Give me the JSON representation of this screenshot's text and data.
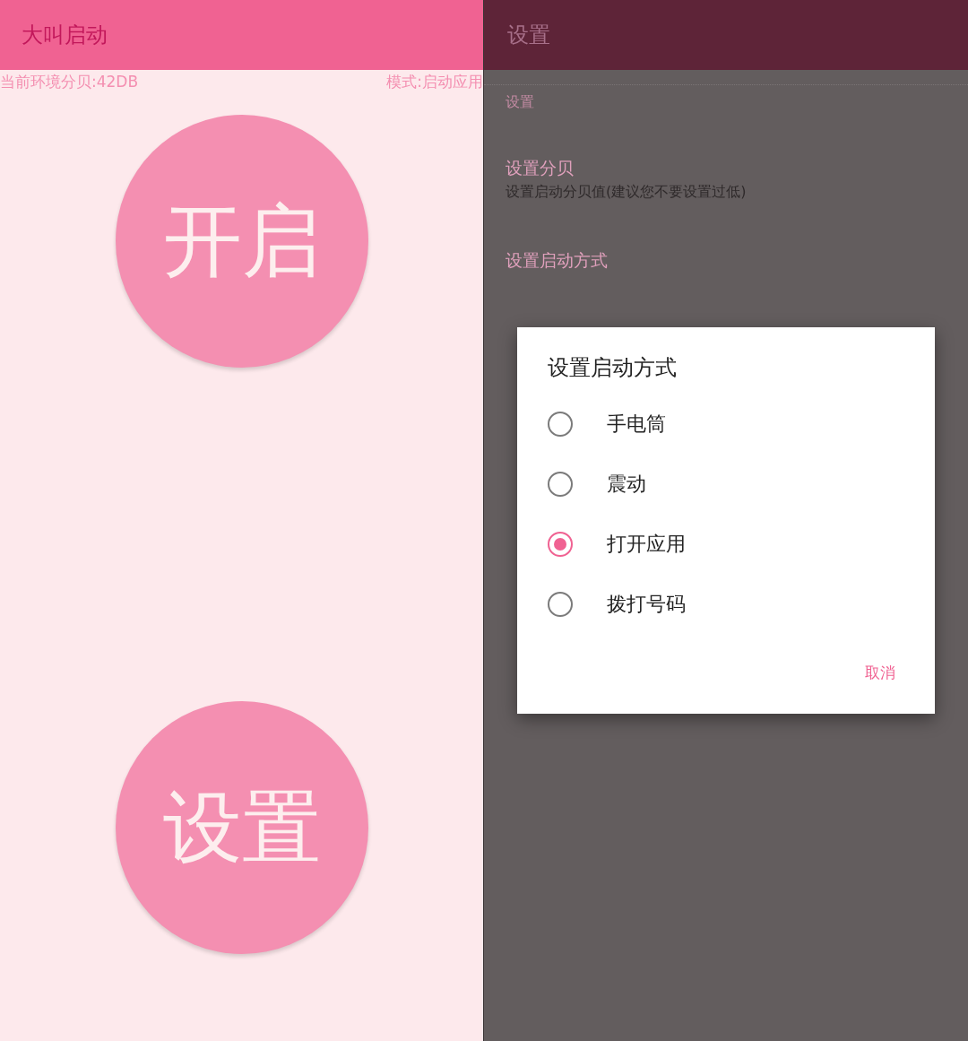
{
  "main_screen": {
    "title": "大叫启动",
    "decibel_reading": "当前环境分贝:42DB",
    "mode": "模式:启动应用",
    "start_button": "开启",
    "settings_button": "设置"
  },
  "settings_screen": {
    "title": "设置",
    "category": "设置",
    "items": [
      {
        "title": "设置分贝",
        "summary": "设置启动分贝值(建议您不要设置过低)"
      },
      {
        "title": "设置启动方式"
      }
    ]
  },
  "dialog": {
    "title": "设置启动方式",
    "options": [
      {
        "label": "手电筒",
        "selected": false
      },
      {
        "label": "震动",
        "selected": false
      },
      {
        "label": "打开应用",
        "selected": true
      },
      {
        "label": "拨打号码",
        "selected": false
      }
    ],
    "cancel": "取消"
  }
}
